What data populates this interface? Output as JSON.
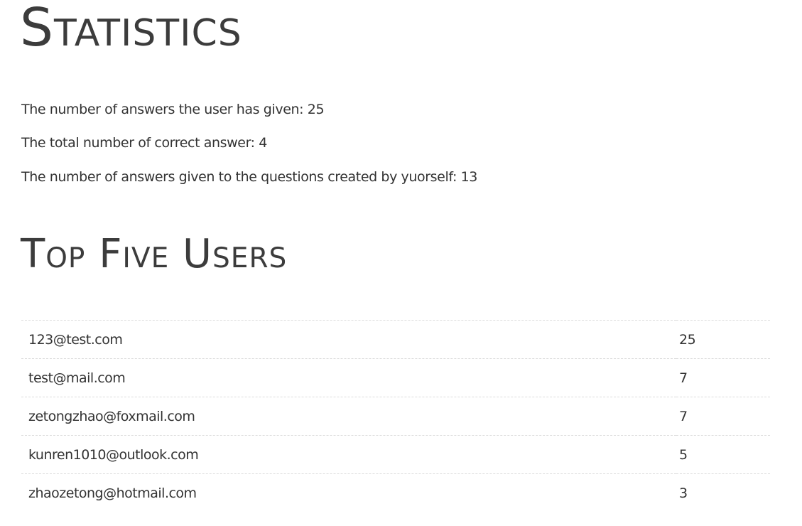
{
  "statistics": {
    "title": "Statistics",
    "answers_given": "The number of answers the user has given: 25",
    "correct_answers": "The total number of correct answer: 4",
    "answers_to_own_questions": "The number of answers given to the questions created by yuorself: 13"
  },
  "top_users": {
    "title": "Top Five Users",
    "rows": [
      {
        "email": "123@test.com",
        "count": "25"
      },
      {
        "email": "test@mail.com",
        "count": "7"
      },
      {
        "email": "zetongzhao@foxmail.com",
        "count": "7"
      },
      {
        "email": "kunren1010@outlook.com",
        "count": "5"
      },
      {
        "email": "zhaozetong@hotmail.com",
        "count": "3"
      }
    ]
  }
}
